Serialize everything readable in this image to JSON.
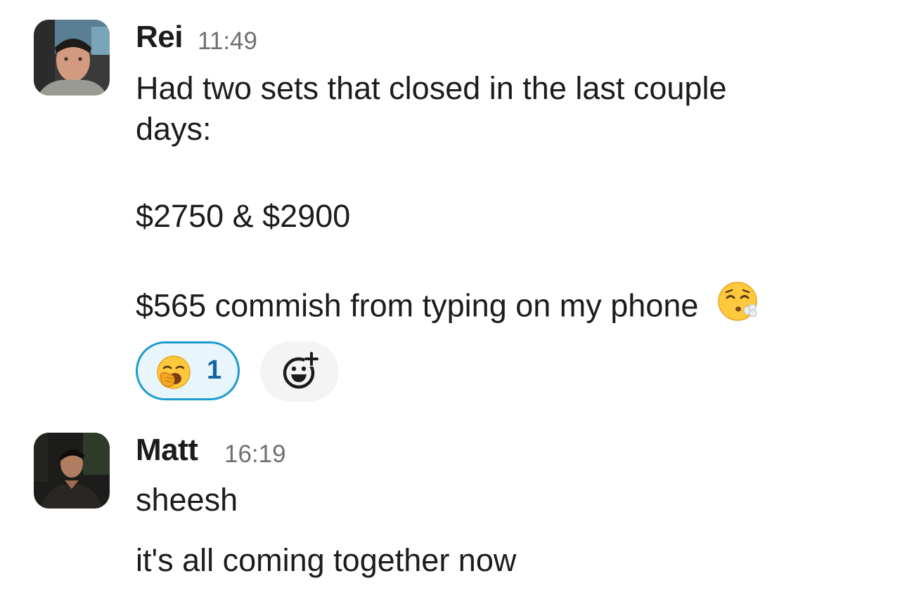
{
  "messages": [
    {
      "sender": "Rei",
      "time": "11:49",
      "avatar": "rei-avatar",
      "lines": [
        "Had two sets that closed in the last couple",
        "days:",
        "$2750 & $2900",
        "$565 commish from typing on my phone"
      ],
      "inline_emoji": "face-exhaling-icon",
      "reactions": [
        {
          "emoji": "yawning-face-icon",
          "count": "1",
          "selected": true
        }
      ],
      "add_reaction_icon": "add-reaction-icon"
    },
    {
      "sender": "Matt",
      "time": "16:19",
      "avatar": "matt-avatar",
      "lines": [
        "sheesh",
        "it's all coming together now"
      ]
    }
  ],
  "colors": {
    "reaction_border": "#1d9bd1",
    "reaction_bg": "#e8f5fa",
    "reaction_count": "#1264a3",
    "timestamp": "#707070"
  }
}
